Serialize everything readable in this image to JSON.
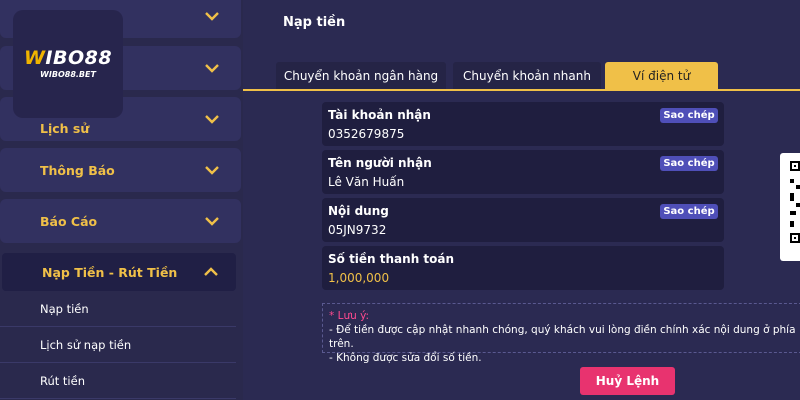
{
  "logo": {
    "brand_accent": "W",
    "brand_rest": "IBO88",
    "domain": "WIBO88.BET"
  },
  "sidebar": {
    "items": [
      {
        "label": "Lịch sử"
      },
      {
        "label": "Thông Báo"
      },
      {
        "label": "Báo Cáo"
      },
      {
        "label": "Nạp Tiền - Rút Tiền"
      }
    ],
    "subitems": [
      {
        "label": "Nạp tiền"
      },
      {
        "label": "Lịch sử nạp tiền"
      },
      {
        "label": "Rút tiền"
      }
    ]
  },
  "main": {
    "title": "Nạp tiền",
    "tabs": [
      {
        "label": "Chuyển khoản ngân hàng"
      },
      {
        "label": "Chuyển khoản nhanh"
      },
      {
        "label": "Ví điện tử"
      }
    ],
    "fields": [
      {
        "label": "Tài khoản nhận",
        "value": "0352679875",
        "copy_label": "Sao chép"
      },
      {
        "label": "Tên người nhận",
        "value": "Lê Văn Huấn",
        "copy_label": "Sao chép"
      },
      {
        "label": "Nội dung",
        "value": "05JN9732",
        "copy_label": "Sao chép"
      },
      {
        "label": "Số tiền thanh toán",
        "value": "1,000,000"
      }
    ],
    "note": {
      "title": "* Lưu ý:",
      "lines": [
        "- Để tiền được cập nhật nhanh chóng, quý khách vui lòng điền chính xác nội dung ở phía trên.",
        "- Không được sửa đổi số tiền."
      ]
    },
    "cancel_label": "Huỷ Lệnh"
  },
  "colors": {
    "accent": "#f0c048",
    "copy_button": "#4f4fb8",
    "cancel_button": "#e8336f",
    "background": "#2b2a52"
  },
  "icons": {
    "chevron": "chevron-down-icon",
    "chevron_open": "chevron-up-icon",
    "qr": "qr-code-icon"
  }
}
